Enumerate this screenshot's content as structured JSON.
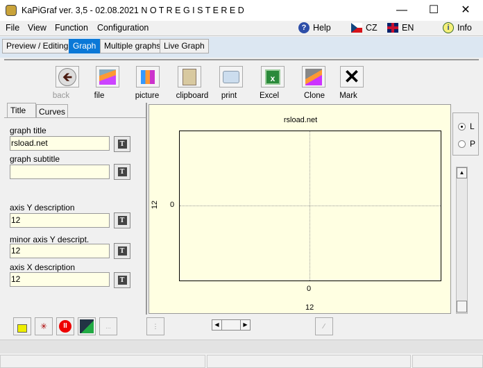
{
  "window": {
    "title": "KaPiGraf  ver. 3,5  - 02.08.2021   N O T  R E G I S T E R E D"
  },
  "menu": [
    "File",
    "View",
    "Function",
    "Configuration"
  ],
  "menu_right": {
    "help": "Help",
    "cz": "CZ",
    "en": "EN",
    "info": "Info"
  },
  "tabs": [
    {
      "label": "Preview / Editing"
    },
    {
      "label": "Graph",
      "active": true
    },
    {
      "label": "Multiple graphs"
    },
    {
      "label": "Live Graph"
    }
  ],
  "toolbar": [
    "back",
    "file",
    "picture",
    "clipboard",
    "print",
    "Excel",
    "Clone",
    "Mark"
  ],
  "left_tabs": [
    "Title",
    "Curves"
  ],
  "fields": {
    "graph_title": {
      "label": "graph title",
      "value": "rsload.net"
    },
    "graph_subtitle": {
      "label": "graph subtitle",
      "value": ""
    },
    "axis_y": {
      "label": "axis Y description",
      "value": "12"
    },
    "minor_axis_y": {
      "label": "minor axis Y descript.",
      "value": "12"
    },
    "axis_x": {
      "label": "axis X description",
      "value": "12"
    }
  },
  "graph": {
    "title": "rsload.net",
    "y_label": "12",
    "x_label": "12",
    "y_tick": "0",
    "x_tick": "0"
  },
  "orientation": {
    "options": [
      "L",
      "P"
    ],
    "selected": "L"
  },
  "bottom": {
    "more": "..."
  },
  "colors": {
    "accent": "#0a78d7",
    "chart_bg": "#ffffe2",
    "tab_bar": "#dce7f2"
  }
}
